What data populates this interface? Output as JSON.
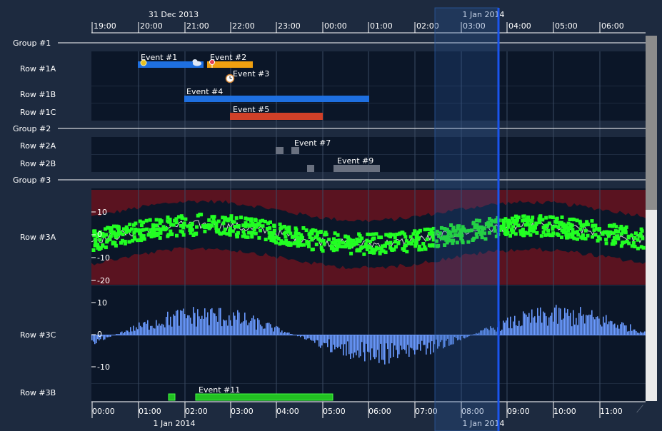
{
  "header": {
    "top_date_left": "31 Dec 2013",
    "top_date_right": "1 Jan 2014",
    "top_ticks": [
      "19:00",
      "20:00",
      "21:00",
      "22:00",
      "23:00",
      "00:00",
      "01:00",
      "02:00",
      "03:00",
      "04:00",
      "05:00",
      "06:00"
    ]
  },
  "footer": {
    "bottom_date_left": "1 Jan 2014",
    "bottom_date_right": "1 Jan 2014",
    "bottom_ticks": [
      "00:00",
      "01:00",
      "02:00",
      "03:00",
      "04:00",
      "05:00",
      "06:00",
      "07:00",
      "08:00",
      "09:00",
      "10:00",
      "11:00"
    ]
  },
  "groups": [
    "Group #1",
    "Group #2",
    "Group #3"
  ],
  "rows": [
    "Row #1A",
    "Row #1B",
    "Row #1C",
    "Row #2A",
    "Row #2B",
    "Row #3A",
    "Row #3C",
    "Row #3B"
  ],
  "events": {
    "e1": "Event #1",
    "e2": "Event #2",
    "e3": "Event #3",
    "e4": "Event #4",
    "e5": "Event #5",
    "e7": "Event #7",
    "e9": "Event #9",
    "e11": "Event #11"
  },
  "row3a_axis": [
    "10",
    "0",
    "-10",
    "-20"
  ],
  "row3c_axis": [
    "10",
    "0",
    "-10"
  ],
  "icons": {
    "e1": "sun-icon",
    "e1b": "cloud-icon",
    "e2": "pin-icon",
    "e3": "clock-icon",
    "grip": "resize-grip-icon"
  },
  "colors": {
    "background": "#1d2a3f",
    "plot_bg": "#0b1628",
    "blue_bar": "#1e6fe0",
    "orange_bar": "#f0a010",
    "red_bar": "#d04028",
    "gray_box": "#6a7180",
    "green_points": "#22ff22",
    "red_band": "#5a1320",
    "signal_blue": "#6a9aff",
    "selection": "#2a5aa0"
  }
}
